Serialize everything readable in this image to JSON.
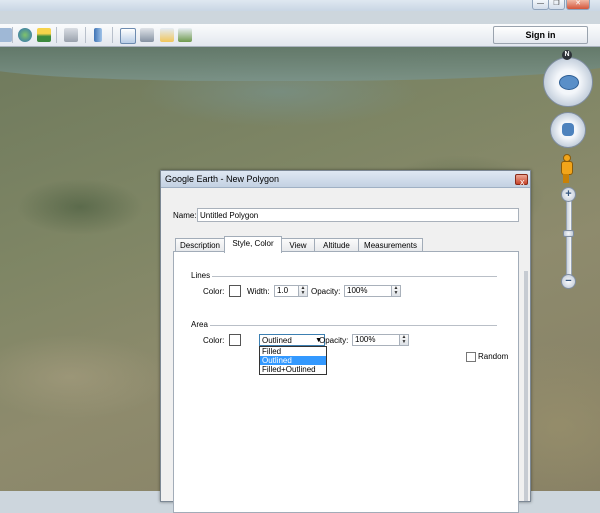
{
  "window": {
    "minimize": "—",
    "restore": "❐",
    "close": "✕"
  },
  "toolbar": {
    "signin_label": "Sign in",
    "icons": [
      "earth-history-icon",
      "sunlight-icon",
      "planet-icon",
      "ruler-icon",
      "email-icon",
      "print-icon",
      "maps-icon",
      "photo-icon"
    ]
  },
  "nav": {
    "north_label": "N",
    "zoom_in": "+",
    "zoom_out": "−"
  },
  "dialog": {
    "title": "Google Earth - New Polygon",
    "close": "x",
    "name_label": "Name:",
    "name_value": "Untitled Polygon",
    "tabs": [
      {
        "label": "Description",
        "active": false
      },
      {
        "label": "Style, Color",
        "active": true
      },
      {
        "label": "View",
        "active": false
      },
      {
        "label": "Altitude",
        "active": false
      },
      {
        "label": "Measurements",
        "active": false
      }
    ],
    "lines": {
      "group_label": "Lines",
      "color_label": "Color:",
      "width_label": "Width:",
      "width_value": "1.0",
      "opacity_label": "Opacity:",
      "opacity_value": "100%"
    },
    "area": {
      "group_label": "Area",
      "color_label": "Color:",
      "fill_selected": "Outlined",
      "opacity_label": "Opacity:",
      "opacity_value": "100%",
      "options": [
        {
          "label": "Filled",
          "selected": false
        },
        {
          "label": "Outlined",
          "selected": true
        },
        {
          "label": "Filled+Outlined",
          "selected": false
        }
      ],
      "random_label": "Random"
    }
  }
}
